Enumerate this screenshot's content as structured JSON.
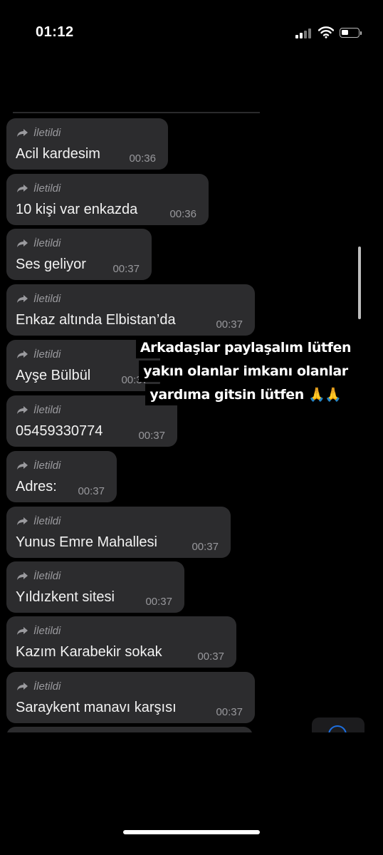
{
  "status_bar": {
    "time": "01:12"
  },
  "forward_label": "İletildi",
  "messages": [
    {
      "text": "Acil kardesim",
      "time": "00:36"
    },
    {
      "text": "10 kişi var enkazda",
      "time": "00:36"
    },
    {
      "text": "Ses geliyor",
      "time": "00:37"
    },
    {
      "text": "Enkaz altında Elbistan’da",
      "time": "00:37"
    },
    {
      "text": "Ayşe Bülbül",
      "time": "00:37"
    },
    {
      "text": "05459330774",
      "time": "00:37"
    },
    {
      "text": "Adres:",
      "time": "00:37"
    },
    {
      "text": "Yunus Emre Mahallesi",
      "time": "00:37"
    },
    {
      "text": "Yıldızkent sitesi",
      "time": "00:37"
    },
    {
      "text": "Kazım Karabekir sokak",
      "time": "00:37"
    },
    {
      "text": "Saraykent manavı karşısı",
      "time": "00:37"
    }
  ],
  "overlay": {
    "line1": "Arkadaşlar paylaşalım lütfen",
    "line2": "yakın olanlar imkanı olanlar",
    "line3": "yardıma gitsin lütfen",
    "emoji": "🙏🙏"
  },
  "colors": {
    "bubble": "#2c2c2e",
    "background": "#000000",
    "accent": "#1d6fe0"
  },
  "icons": {
    "forward": "forward-arrow-icon",
    "signal": "signal-icon",
    "wifi": "wifi-icon",
    "battery": "battery-icon"
  }
}
